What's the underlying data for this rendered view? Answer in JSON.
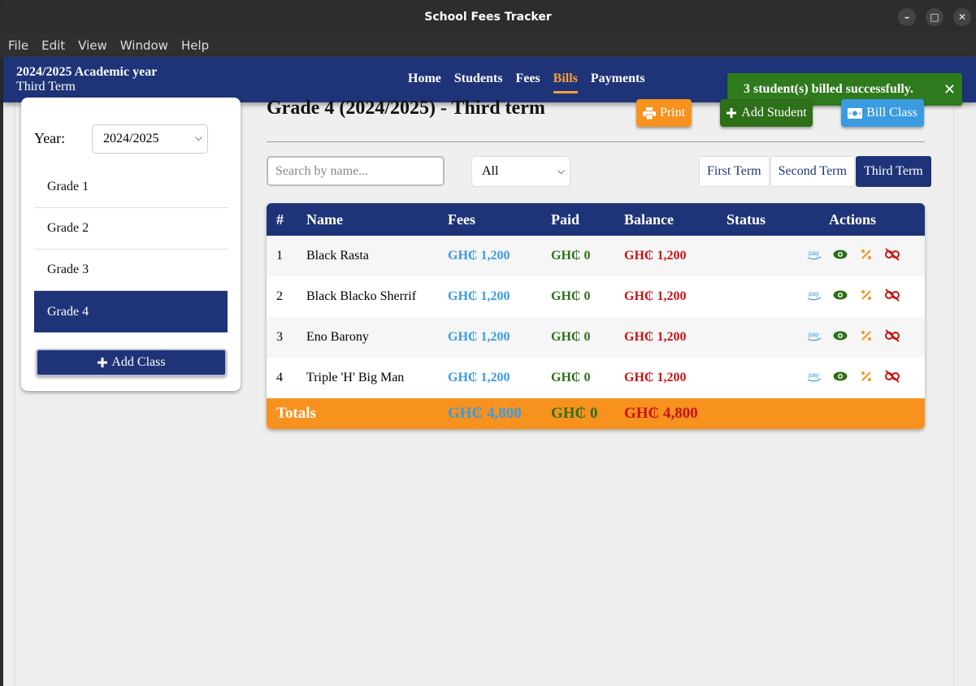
{
  "window": {
    "title": "School Fees Tracker",
    "controls": [
      "–",
      "□",
      "✕"
    ]
  },
  "menu": [
    "File",
    "Edit",
    "View",
    "Window",
    "Help"
  ],
  "header": {
    "academic_year": "2024/2025 Academic year",
    "term": "Third Term",
    "nav": [
      "Home",
      "Students",
      "Fees",
      "Bills",
      "Payments"
    ],
    "active_nav": "Bills"
  },
  "toast": {
    "message": "3 student(s) billed successfully.",
    "close": "✕"
  },
  "sidebar": {
    "year_label": "Year:",
    "year_value": "2024/2025",
    "grades": [
      "Grade 1",
      "Grade 2",
      "Grade 3",
      "Grade 4"
    ],
    "active_grade": "Grade 4",
    "add_class_label": "Add Class"
  },
  "main": {
    "title": "Grade 4 (2024/2025) - Third term",
    "print_label": "Print",
    "add_student_label": "Add Student",
    "bill_class_label": "Bill Class",
    "search_placeholder": "Search by name...",
    "filter_value": "All",
    "terms": [
      "First Term",
      "Second Term",
      "Third Term"
    ],
    "active_term": "Third Term"
  },
  "table": {
    "headers": [
      "#",
      "Name",
      "Fees",
      "Paid",
      "Balance",
      "Status",
      "Actions"
    ],
    "rows": [
      {
        "num": "1",
        "name": "Black Rasta",
        "fees": "GH₵ 1,200",
        "paid": "GH₵ 0",
        "balance": "GH₵ 1,200",
        "status": ""
      },
      {
        "num": "2",
        "name": "Black Blacko Sherrif",
        "fees": "GH₵ 1,200",
        "paid": "GH₵ 0",
        "balance": "GH₵ 1,200",
        "status": ""
      },
      {
        "num": "3",
        "name": "Eno Barony",
        "fees": "GH₵ 1,200",
        "paid": "GH₵ 0",
        "balance": "GH₵ 1,200",
        "status": ""
      },
      {
        "num": "4",
        "name": "Triple 'H' Big Man",
        "fees": "GH₵ 1,200",
        "paid": "GH₵ 0",
        "balance": "GH₵ 1,200",
        "status": ""
      }
    ],
    "totals": {
      "label": "Totals",
      "fees": "GH₵ 4,800",
      "paid": "GH₵ 0",
      "balance": "GH₵ 4,800"
    },
    "action_icons": [
      "pay-icon",
      "eye-icon",
      "percent-icon",
      "unlink-icon"
    ]
  },
  "colors": {
    "primary": "#1f3478",
    "orange": "#f7921e",
    "green": "#2e6f19",
    "blue": "#3a9be0",
    "red": "#c51515",
    "toast": "#2e7a1c"
  }
}
